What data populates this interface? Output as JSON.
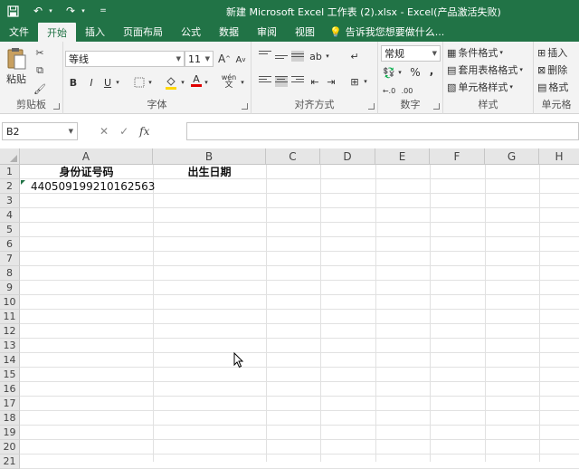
{
  "title_bar": {
    "title": "新建 Microsoft Excel 工作表 (2).xlsx - Excel(产品激活失败)",
    "qat_icons": [
      "save-icon",
      "undo-icon",
      "redo-icon",
      "customize-icon"
    ]
  },
  "tabs": [
    {
      "label": "文件"
    },
    {
      "label": "开始",
      "active": true
    },
    {
      "label": "插入"
    },
    {
      "label": "页面布局"
    },
    {
      "label": "公式"
    },
    {
      "label": "数据"
    },
    {
      "label": "审阅"
    },
    {
      "label": "视图"
    }
  ],
  "tell_me": "告诉我您想要做什么...",
  "ribbon": {
    "clipboard": {
      "label": "剪贴板",
      "paste_label": "粘贴"
    },
    "font": {
      "label": "字体",
      "font_name": "等线",
      "font_size": "11",
      "bold": "B",
      "italic": "I",
      "underline": "U",
      "grow": "A",
      "shrink": "A",
      "font_color": "A",
      "phonetic": "wén"
    },
    "alignment": {
      "label": "对齐方式"
    },
    "number": {
      "label": "数字",
      "format": "常规",
      "percent": "%",
      "comma": ","
    },
    "styles": {
      "label": "样式",
      "conditional": "条件格式",
      "table_format": "套用表格格式",
      "cell_styles": "单元格样式"
    },
    "cells": {
      "label": "单元格",
      "insert": "插入",
      "delete": "删除",
      "format": "格式"
    }
  },
  "formula_bar": {
    "name_box": "B2",
    "fx": "fx",
    "content": ""
  },
  "columns": [
    "A",
    "B",
    "C",
    "D",
    "E",
    "F",
    "G",
    "H"
  ],
  "rows": [
    "1",
    "2",
    "3",
    "4",
    "5",
    "6",
    "7",
    "8",
    "9",
    "10",
    "11",
    "12",
    "13",
    "14",
    "15",
    "16",
    "17",
    "18",
    "19",
    "20",
    "21"
  ],
  "cells": {
    "A1": "身份证号码",
    "B1": "出生日期",
    "A2": "440509199210162563"
  },
  "colors": {
    "accent": "#217346"
  }
}
